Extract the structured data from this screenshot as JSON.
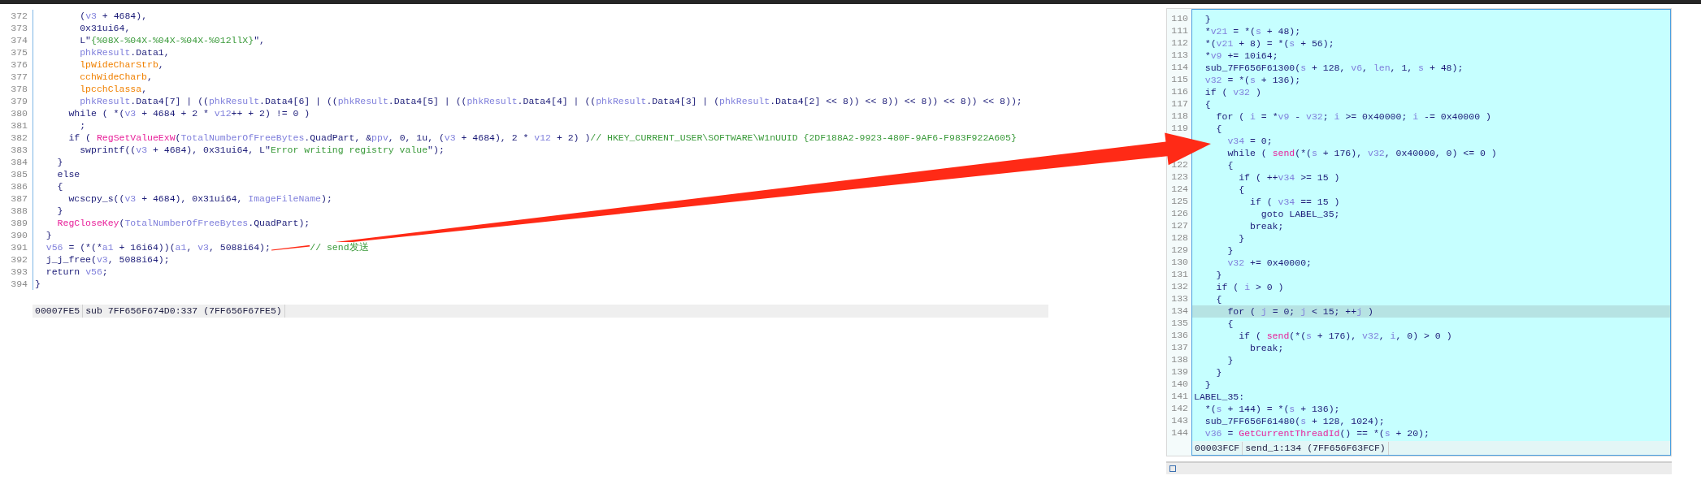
{
  "left": {
    "lines": [
      {
        "number": "372",
        "tokens": [
          {
            "kind": "plain",
            "text": "        ("
          },
          {
            "kind": "var",
            "text": "v3"
          },
          {
            "kind": "plain",
            "text": " + 4684),"
          }
        ]
      },
      {
        "number": "373",
        "tokens": [
          {
            "kind": "plain",
            "text": "        0x31ui64,"
          }
        ]
      },
      {
        "number": "374",
        "tokens": [
          {
            "kind": "plain",
            "text": "        L\""
          },
          {
            "kind": "string",
            "text": "{%08X-%04X-%04X-%04X-%012llX}"
          },
          {
            "kind": "plain",
            "text": "\","
          }
        ]
      },
      {
        "number": "375",
        "tokens": [
          {
            "kind": "var",
            "text": "        phkResult"
          },
          {
            "kind": "plain",
            "text": ".Data1,"
          }
        ]
      },
      {
        "number": "376",
        "tokens": [
          {
            "kind": "local",
            "text": "        lpWideCharStrb"
          },
          {
            "kind": "plain",
            "text": ","
          }
        ]
      },
      {
        "number": "377",
        "tokens": [
          {
            "kind": "local",
            "text": "        cchWideCharb"
          },
          {
            "kind": "plain",
            "text": ","
          }
        ]
      },
      {
        "number": "378",
        "tokens": [
          {
            "kind": "local",
            "text": "        lpcchClassa"
          },
          {
            "kind": "plain",
            "text": ","
          }
        ]
      },
      {
        "number": "379",
        "tokens": [
          {
            "kind": "var",
            "text": "        phkResult"
          },
          {
            "kind": "plain",
            "text": ".Data4[7] | (("
          },
          {
            "kind": "var",
            "text": "phkResult"
          },
          {
            "kind": "plain",
            "text": ".Data4[6] | (("
          },
          {
            "kind": "var",
            "text": "phkResult"
          },
          {
            "kind": "plain",
            "text": ".Data4[5] | (("
          },
          {
            "kind": "var",
            "text": "phkResult"
          },
          {
            "kind": "plain",
            "text": ".Data4[4] | (("
          },
          {
            "kind": "var",
            "text": "phkResult"
          },
          {
            "kind": "plain",
            "text": ".Data4[3] | ("
          },
          {
            "kind": "var",
            "text": "phkResult"
          },
          {
            "kind": "plain",
            "text": ".Data4[2] << 8)) << 8)) << 8)) << 8)) << 8));"
          }
        ]
      },
      {
        "number": "380",
        "tokens": [
          {
            "kind": "plain",
            "text": "      while ( *("
          },
          {
            "kind": "var",
            "text": "v3"
          },
          {
            "kind": "plain",
            "text": " + 4684 + 2 * "
          },
          {
            "kind": "var",
            "text": "v12"
          },
          {
            "kind": "plain",
            "text": "++ + 2) != 0 )"
          }
        ]
      },
      {
        "number": "381",
        "tokens": [
          {
            "kind": "plain",
            "text": "        ;"
          }
        ]
      },
      {
        "number": "382",
        "tokens": [
          {
            "kind": "plain",
            "text": "      if ( "
          },
          {
            "kind": "func",
            "text": "RegSetValueExW"
          },
          {
            "kind": "plain",
            "text": "("
          },
          {
            "kind": "var",
            "text": "TotalNumberOfFreeBytes"
          },
          {
            "kind": "plain",
            "text": ".QuadPart, &"
          },
          {
            "kind": "var",
            "text": "ppv"
          },
          {
            "kind": "plain",
            "text": ", 0, 1u, ("
          },
          {
            "kind": "var",
            "text": "v3"
          },
          {
            "kind": "plain",
            "text": " + 4684), 2 * "
          },
          {
            "kind": "var",
            "text": "v12"
          },
          {
            "kind": "plain",
            "text": " + 2) )"
          },
          {
            "kind": "comment",
            "text": "// HKEY_CURRENT_USER\\SOFTWARE\\W1nUUID {2DF188A2-9923-480F-9AF6-F983F922A605}"
          }
        ]
      },
      {
        "number": "383",
        "tokens": [
          {
            "kind": "plain",
            "text": "        swprintf(("
          },
          {
            "kind": "var",
            "text": "v3"
          },
          {
            "kind": "plain",
            "text": " + 4684), 0x31ui64, L\""
          },
          {
            "kind": "string",
            "text": "Error writing registry value"
          },
          {
            "kind": "plain",
            "text": "\");"
          }
        ]
      },
      {
        "number": "384",
        "tokens": [
          {
            "kind": "plain",
            "text": "    }"
          }
        ]
      },
      {
        "number": "385",
        "tokens": [
          {
            "kind": "plain",
            "text": "    else"
          }
        ]
      },
      {
        "number": "386",
        "tokens": [
          {
            "kind": "plain",
            "text": "    {"
          }
        ]
      },
      {
        "number": "387",
        "tokens": [
          {
            "kind": "plain",
            "text": "      wcscpy_s(("
          },
          {
            "kind": "var",
            "text": "v3"
          },
          {
            "kind": "plain",
            "text": " + 4684), 0x31ui64, "
          },
          {
            "kind": "var",
            "text": "ImageFileName"
          },
          {
            "kind": "plain",
            "text": ");"
          }
        ]
      },
      {
        "number": "388",
        "tokens": [
          {
            "kind": "plain",
            "text": "    }"
          }
        ]
      },
      {
        "number": "389",
        "tokens": [
          {
            "kind": "func",
            "text": "    RegCloseKey"
          },
          {
            "kind": "plain",
            "text": "("
          },
          {
            "kind": "var",
            "text": "TotalNumberOfFreeBytes"
          },
          {
            "kind": "plain",
            "text": ".QuadPart);"
          }
        ]
      },
      {
        "number": "390",
        "tokens": [
          {
            "kind": "plain",
            "text": "  }"
          }
        ]
      },
      {
        "number": "391",
        "tokens": [
          {
            "kind": "var",
            "text": "  v56"
          },
          {
            "kind": "plain",
            "text": " = (*(*"
          },
          {
            "kind": "var",
            "text": "a1"
          },
          {
            "kind": "plain",
            "text": " + 16i64))("
          },
          {
            "kind": "var",
            "text": "a1"
          },
          {
            "kind": "plain",
            "text": ", "
          },
          {
            "kind": "var",
            "text": "v3"
          },
          {
            "kind": "plain",
            "text": ", 5088i64);       "
          },
          {
            "kind": "comment",
            "text": "// send发送"
          }
        ]
      },
      {
        "number": "392",
        "tokens": [
          {
            "kind": "plain",
            "text": "  j_j_free("
          },
          {
            "kind": "var",
            "text": "v3"
          },
          {
            "kind": "plain",
            "text": ", 5088i64);"
          }
        ]
      },
      {
        "number": "393",
        "tokens": [
          {
            "kind": "plain",
            "text": "  return "
          },
          {
            "kind": "var",
            "text": "v56"
          },
          {
            "kind": "plain",
            "text": ";"
          }
        ]
      },
      {
        "number": "394",
        "tokens": [
          {
            "kind": "plain",
            "text": "}"
          }
        ]
      }
    ],
    "status_bar": {
      "address": "00007FE5",
      "location": "sub 7FF656F674D0:337 (7FF656F67FE5)"
    }
  },
  "right": {
    "lines": [
      {
        "number": "110",
        "highlighted": false,
        "tokens": [
          {
            "kind": "plain",
            "text": "  }"
          }
        ]
      },
      {
        "number": "111",
        "highlighted": false,
        "tokens": [
          {
            "kind": "plain",
            "text": "  *"
          },
          {
            "kind": "var",
            "text": "v21"
          },
          {
            "kind": "plain",
            "text": " = *("
          },
          {
            "kind": "var",
            "text": "s"
          },
          {
            "kind": "plain",
            "text": " + 48);"
          }
        ]
      },
      {
        "number": "112",
        "highlighted": false,
        "tokens": [
          {
            "kind": "plain",
            "text": "  *("
          },
          {
            "kind": "var",
            "text": "v21"
          },
          {
            "kind": "plain",
            "text": " + 8) = *("
          },
          {
            "kind": "var",
            "text": "s"
          },
          {
            "kind": "plain",
            "text": " + 56);"
          }
        ]
      },
      {
        "number": "113",
        "highlighted": false,
        "tokens": [
          {
            "kind": "plain",
            "text": "  *"
          },
          {
            "kind": "var",
            "text": "v9"
          },
          {
            "kind": "plain",
            "text": " += 10i64;"
          }
        ]
      },
      {
        "number": "114",
        "highlighted": false,
        "tokens": [
          {
            "kind": "plain",
            "text": "  sub_7FF656F61300("
          },
          {
            "kind": "var",
            "text": "s"
          },
          {
            "kind": "plain",
            "text": " + 128, "
          },
          {
            "kind": "var",
            "text": "v6"
          },
          {
            "kind": "plain",
            "text": ", "
          },
          {
            "kind": "var",
            "text": "len"
          },
          {
            "kind": "plain",
            "text": ", 1, "
          },
          {
            "kind": "var",
            "text": "s"
          },
          {
            "kind": "plain",
            "text": " + 48);"
          }
        ]
      },
      {
        "number": "115",
        "highlighted": false,
        "tokens": [
          {
            "kind": "var",
            "text": "  v32"
          },
          {
            "kind": "plain",
            "text": " = *("
          },
          {
            "kind": "var",
            "text": "s"
          },
          {
            "kind": "plain",
            "text": " + 136);"
          }
        ]
      },
      {
        "number": "116",
        "highlighted": false,
        "tokens": [
          {
            "kind": "plain",
            "text": "  if ( "
          },
          {
            "kind": "var",
            "text": "v32"
          },
          {
            "kind": "plain",
            "text": " )"
          }
        ]
      },
      {
        "number": "117",
        "highlighted": false,
        "tokens": [
          {
            "kind": "plain",
            "text": "  {"
          }
        ]
      },
      {
        "number": "118",
        "highlighted": false,
        "tokens": [
          {
            "kind": "plain",
            "text": "    for ( "
          },
          {
            "kind": "var",
            "text": "i"
          },
          {
            "kind": "plain",
            "text": " = *"
          },
          {
            "kind": "var",
            "text": "v9"
          },
          {
            "kind": "plain",
            "text": " - "
          },
          {
            "kind": "var",
            "text": "v32"
          },
          {
            "kind": "plain",
            "text": "; "
          },
          {
            "kind": "var",
            "text": "i"
          },
          {
            "kind": "plain",
            "text": " >= 0x40000; "
          },
          {
            "kind": "var",
            "text": "i"
          },
          {
            "kind": "plain",
            "text": " -= 0x40000 )"
          }
        ]
      },
      {
        "number": "119",
        "highlighted": false,
        "tokens": [
          {
            "kind": "plain",
            "text": "    {"
          }
        ]
      },
      {
        "highlighted": false,
        "tokens": [
          {
            "kind": "var",
            "text": "      v34"
          },
          {
            "kind": "plain",
            "text": " = 0;"
          }
        ]
      },
      {
        "highlighted": false,
        "tokens": [
          {
            "kind": "plain",
            "text": "      while ( "
          },
          {
            "kind": "func",
            "text": "send"
          },
          {
            "kind": "plain",
            "text": "(*("
          },
          {
            "kind": "var",
            "text": "s"
          },
          {
            "kind": "plain",
            "text": " + 176), "
          },
          {
            "kind": "var",
            "text": "v32"
          },
          {
            "kind": "plain",
            "text": ", 0x40000, 0) <= 0 )"
          }
        ]
      },
      {
        "number": "122",
        "highlighted": false,
        "tokens": [
          {
            "kind": "plain",
            "text": "      {"
          }
        ]
      },
      {
        "number": "123",
        "highlighted": false,
        "tokens": [
          {
            "kind": "plain",
            "text": "        if ( ++"
          },
          {
            "kind": "var",
            "text": "v34"
          },
          {
            "kind": "plain",
            "text": " >= 15 )"
          }
        ]
      },
      {
        "number": "124",
        "highlighted": false,
        "tokens": [
          {
            "kind": "plain",
            "text": "        {"
          }
        ]
      },
      {
        "number": "125",
        "highlighted": false,
        "tokens": [
          {
            "kind": "plain",
            "text": "          if ( "
          },
          {
            "kind": "var",
            "text": "v34"
          },
          {
            "kind": "plain",
            "text": " == 15 )"
          }
        ]
      },
      {
        "number": "126",
        "highlighted": false,
        "tokens": [
          {
            "kind": "plain",
            "text": "            goto LABEL_35;"
          }
        ]
      },
      {
        "number": "127",
        "highlighted": false,
        "tokens": [
          {
            "kind": "plain",
            "text": "          break;"
          }
        ]
      },
      {
        "number": "128",
        "highlighted": false,
        "tokens": [
          {
            "kind": "plain",
            "text": "        }"
          }
        ]
      },
      {
        "number": "129",
        "highlighted": false,
        "tokens": [
          {
            "kind": "plain",
            "text": "      }"
          }
        ]
      },
      {
        "number": "130",
        "highlighted": false,
        "tokens": [
          {
            "kind": "var",
            "text": "      v32"
          },
          {
            "kind": "plain",
            "text": " += 0x40000;"
          }
        ]
      },
      {
        "number": "131",
        "highlighted": false,
        "tokens": [
          {
            "kind": "plain",
            "text": "    }"
          }
        ]
      },
      {
        "number": "132",
        "highlighted": false,
        "tokens": [
          {
            "kind": "plain",
            "text": "    if ( "
          },
          {
            "kind": "var",
            "text": "i"
          },
          {
            "kind": "plain",
            "text": " > 0 )"
          }
        ]
      },
      {
        "number": "133",
        "highlighted": false,
        "tokens": [
          {
            "kind": "plain",
            "text": "    {"
          }
        ]
      },
      {
        "number": "134",
        "highlighted": true,
        "tokens": [
          {
            "kind": "plain",
            "text": "      for ( "
          },
          {
            "kind": "var",
            "text": "j"
          },
          {
            "kind": "plain",
            "text": " = 0; "
          },
          {
            "kind": "var",
            "text": "j"
          },
          {
            "kind": "plain",
            "text": " < 15; ++"
          },
          {
            "kind": "var",
            "text": "j"
          },
          {
            "kind": "plain",
            "text": " )"
          }
        ]
      },
      {
        "number": "135",
        "highlighted": false,
        "tokens": [
          {
            "kind": "plain",
            "text": "      {"
          }
        ]
      },
      {
        "number": "136",
        "highlighted": false,
        "tokens": [
          {
            "kind": "plain",
            "text": "        if ( "
          },
          {
            "kind": "func",
            "text": "send"
          },
          {
            "kind": "plain",
            "text": "(*("
          },
          {
            "kind": "var",
            "text": "s"
          },
          {
            "kind": "plain",
            "text": " + 176), "
          },
          {
            "kind": "var",
            "text": "v32"
          },
          {
            "kind": "plain",
            "text": ", "
          },
          {
            "kind": "var",
            "text": "i"
          },
          {
            "kind": "plain",
            "text": ", 0) > 0 )"
          }
        ]
      },
      {
        "number": "137",
        "highlighted": false,
        "tokens": [
          {
            "kind": "plain",
            "text": "          break;"
          }
        ]
      },
      {
        "number": "138",
        "highlighted": false,
        "tokens": [
          {
            "kind": "plain",
            "text": "      }"
          }
        ]
      },
      {
        "number": "139",
        "highlighted": false,
        "tokens": [
          {
            "kind": "plain",
            "text": "    }"
          }
        ]
      },
      {
        "number": "140",
        "highlighted": false,
        "tokens": [
          {
            "kind": "plain",
            "text": "  }"
          }
        ]
      },
      {
        "number": "141",
        "highlighted": false,
        "tokens": [
          {
            "kind": "plain",
            "text": "LABEL_35:"
          }
        ]
      },
      {
        "number": "142",
        "highlighted": false,
        "tokens": [
          {
            "kind": "plain",
            "text": "  *("
          },
          {
            "kind": "var",
            "text": "s"
          },
          {
            "kind": "plain",
            "text": " + 144) = *("
          },
          {
            "kind": "var",
            "text": "s"
          },
          {
            "kind": "plain",
            "text": " + 136);"
          }
        ]
      },
      {
        "number": "143",
        "highlighted": false,
        "tokens": [
          {
            "kind": "plain",
            "text": "  sub_7FF656F61480("
          },
          {
            "kind": "var",
            "text": "s"
          },
          {
            "kind": "plain",
            "text": " + 128, 1024);"
          }
        ]
      },
      {
        "number": "144",
        "highlighted": false,
        "tokens": [
          {
            "kind": "var",
            "text": "  v36"
          },
          {
            "kind": "plain",
            "text": " = "
          },
          {
            "kind": "func",
            "text": "GetCurrentThreadId"
          },
          {
            "kind": "plain",
            "text": "() == *("
          },
          {
            "kind": "var",
            "text": "s"
          },
          {
            "kind": "plain",
            "text": " + 20);"
          }
        ]
      }
    ],
    "status_bar": {
      "address": "00003FCF",
      "location": "send_1:134 (7FF656F63FCF)"
    }
  }
}
